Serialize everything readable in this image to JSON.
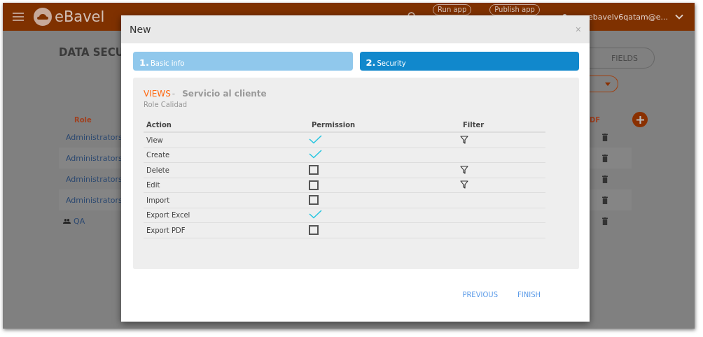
{
  "header": {
    "app_name": "eBavel",
    "run_button": "Run app",
    "publish_button": "Publish app",
    "user": "ebavelv6qatam@e..."
  },
  "background": {
    "title": "DATA SECU",
    "fields_button": "FIELDS",
    "role_column": "Role",
    "pdf_column": "DF",
    "roles": [
      {
        "name": "Administrators"
      },
      {
        "name": "Administrators"
      },
      {
        "name": "Administrators"
      },
      {
        "name": "Administrators"
      },
      {
        "name": "QA"
      }
    ]
  },
  "dialog": {
    "title": "New",
    "close": "×",
    "steps": [
      {
        "number": "1.",
        "label": "Basic info",
        "selected": false
      },
      {
        "number": "2.",
        "label": "Security",
        "selected": true
      }
    ],
    "section": "VIEWS",
    "separator": "-",
    "object": "Servicio al cliente",
    "role": "Role Calidad",
    "columns": [
      "Action",
      "Permission",
      "Filter"
    ],
    "rows": [
      {
        "action": "View",
        "permission": true,
        "filter": true
      },
      {
        "action": "Create",
        "permission": true,
        "filter": false
      },
      {
        "action": "Delete",
        "permission": false,
        "filter": true
      },
      {
        "action": "Edit",
        "permission": false,
        "filter": true
      },
      {
        "action": "Import",
        "permission": false,
        "filter": false
      },
      {
        "action": "Export Excel",
        "permission": true,
        "filter": false
      },
      {
        "action": "Export PDF",
        "permission": false,
        "filter": false
      }
    ],
    "buttons": [
      "PREVIOUS",
      "FINISH"
    ]
  }
}
